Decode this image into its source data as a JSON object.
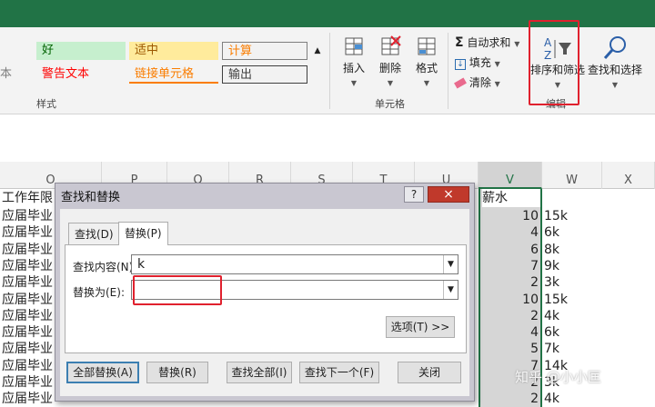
{
  "styles": {
    "row1": [
      {
        "label": "好",
        "bg": "#c6efce",
        "fg": "#006100"
      },
      {
        "label": "适中",
        "bg": "#ffeb9c",
        "fg": "#9c5700"
      },
      {
        "label": "计算",
        "bg": "#f2f2f2",
        "fg": "#fa7d00"
      }
    ],
    "row2": [
      {
        "label": "本",
        "fg": "#7f7f7f"
      },
      {
        "label": "警告文本",
        "fg": "#ff0000"
      },
      {
        "label": "链接单元格",
        "fg": "#fa7d00"
      },
      {
        "label": "输出",
        "fg": "#3f3f3f"
      }
    ],
    "group_label": "样式"
  },
  "cells_group": {
    "insert": "插入",
    "delete": "删除",
    "format": "格式",
    "group_label": "单元格"
  },
  "editing_group": {
    "autosum": "自动求和",
    "fill": "填充",
    "clear": "清除",
    "sort_filter": "排序和筛选",
    "find_select": "查找和选择",
    "group_label": "编辑"
  },
  "columns": [
    "O",
    "P",
    "Q",
    "R",
    "S",
    "T",
    "U",
    "V",
    "W",
    "X"
  ],
  "sheet": {
    "o_header": "工作年限",
    "o_value": "应届毕业",
    "v_header": "薪水",
    "rows": [
      {
        "v": "10",
        "w": "15k"
      },
      {
        "v": "4",
        "w": "6k"
      },
      {
        "v": "6",
        "w": "8k"
      },
      {
        "v": "7",
        "w": "9k"
      },
      {
        "v": "2",
        "w": "3k"
      },
      {
        "v": "10",
        "w": "15k"
      },
      {
        "v": "2",
        "w": "4k"
      },
      {
        "v": "4",
        "w": "6k"
      },
      {
        "v": "5",
        "w": "7k"
      },
      {
        "v": "7",
        "w": "14k"
      },
      {
        "v": "2",
        "w": "3k"
      },
      {
        "v": "2",
        "w": "4k"
      }
    ]
  },
  "dialog": {
    "title": "查找和替换",
    "help": "?",
    "close": "×",
    "tab_find": "查找(D)",
    "tab_replace": "替换(P)",
    "find_label": "查找内容(N):",
    "find_value": "k",
    "replace_label": "替换为(E):",
    "replace_value": "",
    "options_btn": "选项(T) >>",
    "btn_replace_all": "全部替换(A)",
    "btn_replace": "替换(R)",
    "btn_find_all": "查找全部(I)",
    "btn_find_next": "查找下一个(F)",
    "btn_close": "关闭"
  },
  "watermark": "知乎 @小小匡",
  "colors": {
    "excel_green": "#217346",
    "highlight_red": "#e0212e",
    "selection_green": "#217346"
  }
}
